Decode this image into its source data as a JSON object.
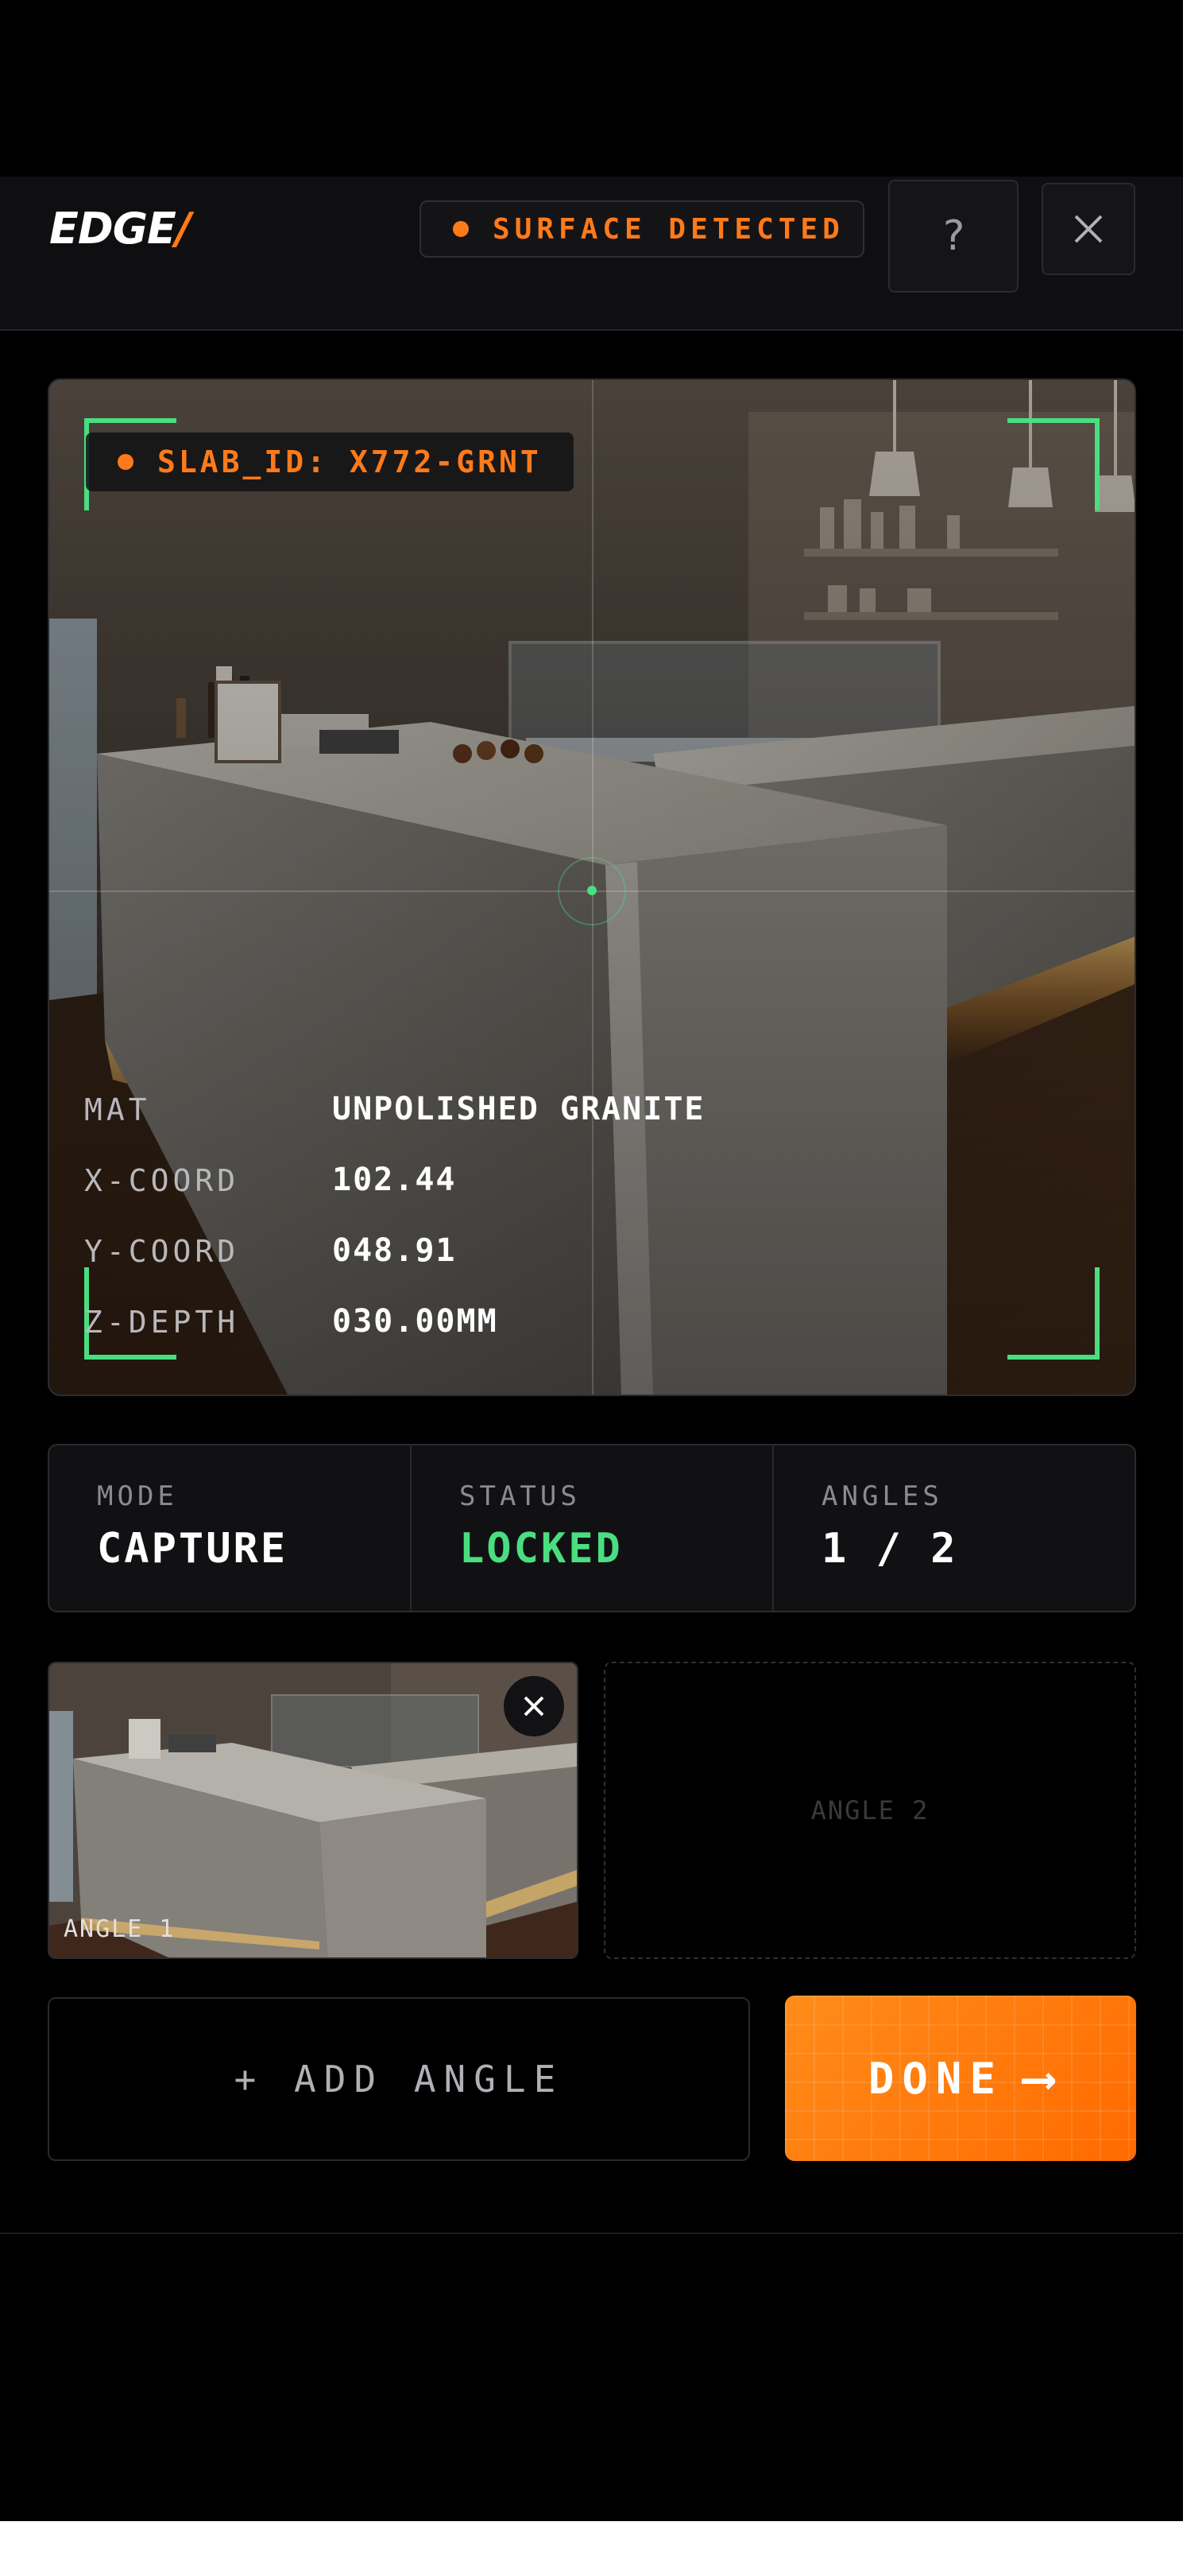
{
  "header": {
    "logo_text": "EDGE",
    "logo_slash": "/",
    "surface_status": "SURFACE DETECTED",
    "help_label": "?",
    "close_icon": "close-icon"
  },
  "viewfinder": {
    "slab_id": "SLAB_ID: X772-GRNT",
    "readout": [
      {
        "key": "MAT",
        "value": "UNPOLISHED GRANITE"
      },
      {
        "key": "X-COORD",
        "value": "102.44"
      },
      {
        "key": "Y-COORD",
        "value": "048.91"
      },
      {
        "key": "Z-DEPTH",
        "value": "030.00MM"
      }
    ]
  },
  "stats": [
    {
      "label": "MODE",
      "value": "CAPTURE"
    },
    {
      "label": "STATUS",
      "value": "LOCKED"
    },
    {
      "label": "ANGLES",
      "value": "1 / 2"
    }
  ],
  "thumbnails": {
    "angle1_label": "ANGLE 1",
    "angle2_label": "ANGLE 2"
  },
  "actions": {
    "add_angle": "+ ADD ANGLE",
    "done": "DONE",
    "done_arrow": "⟶"
  },
  "colors": {
    "accent": "#ff7a1a",
    "lock_green": "#4ade80",
    "background": "#000000"
  }
}
